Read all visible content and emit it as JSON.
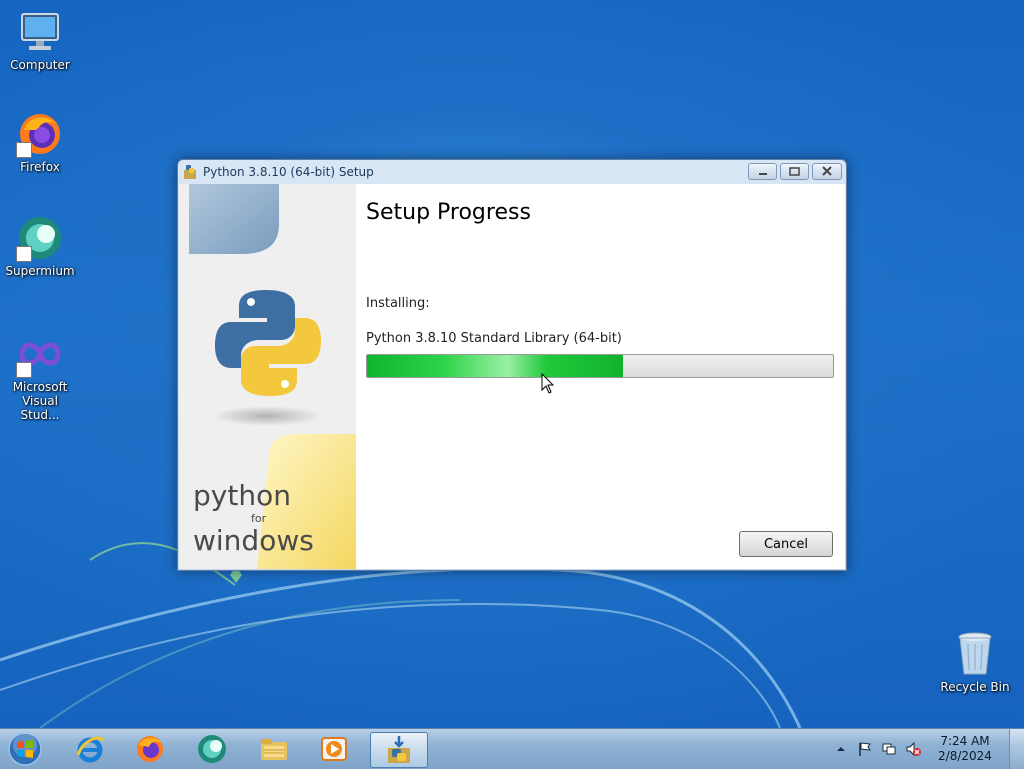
{
  "desktop": {
    "icons": [
      {
        "label": "Computer"
      },
      {
        "label": "Firefox"
      },
      {
        "label": "Supermium"
      },
      {
        "label": "Microsoft Visual Stud..."
      },
      {
        "label": "Recycle Bin"
      }
    ]
  },
  "window": {
    "title": "Python 3.8.10 (64-bit) Setup",
    "heading": "Setup Progress",
    "status_label": "Installing:",
    "current_item": "Python 3.8.10 Standard Library (64-bit)",
    "progress_fraction": 0.55,
    "cancel_label": "Cancel",
    "brand": {
      "word1": "python",
      "word2": "for",
      "word3": "windows"
    }
  },
  "taskbar": {
    "apps": [
      {
        "icon": "internet-explorer-icon"
      },
      {
        "icon": "firefox-icon"
      },
      {
        "icon": "supermium-icon"
      },
      {
        "icon": "file-explorer-icon"
      },
      {
        "icon": "media-player-icon"
      },
      {
        "icon": "python-setup-icon",
        "active": true
      }
    ],
    "clock": {
      "time": "7:24 AM",
      "date": "2/8/2024"
    }
  },
  "colors": {
    "progress": "#1fc23a",
    "desktop": "#1d70c8",
    "python_blue": "#3d6fa3",
    "python_yellow": "#f3c83c"
  }
}
